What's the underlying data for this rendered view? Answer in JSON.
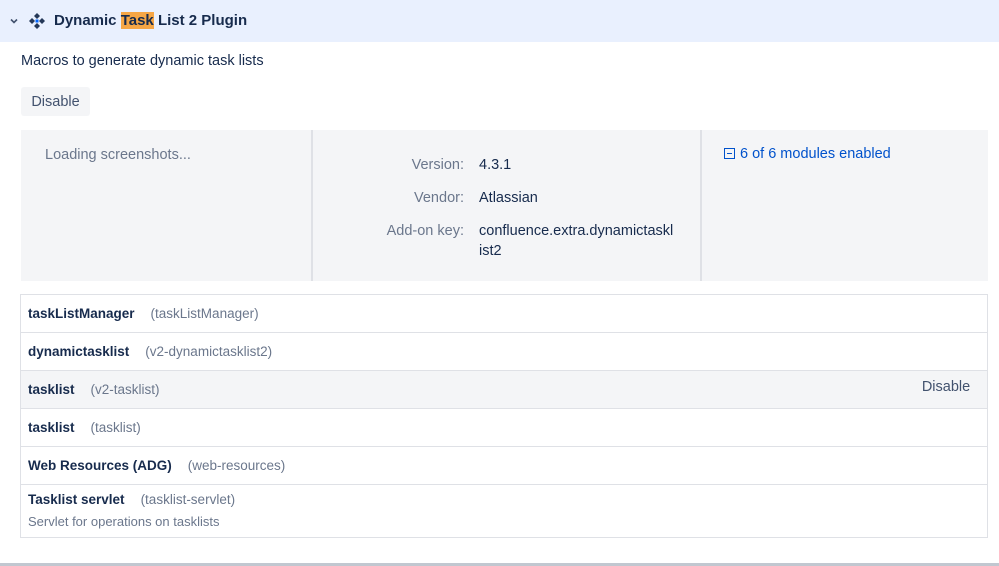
{
  "plugin": {
    "title_prefix": "Dynamic ",
    "title_highlight": "Task",
    "title_suffix": " List 2 Plugin",
    "description": "Macros to generate dynamic task lists",
    "disable_label": "Disable"
  },
  "info": {
    "loading": "Loading screenshots...",
    "version_label": "Version:",
    "version_value": "4.3.1",
    "vendor_label": "Vendor:",
    "vendor_value": "Atlassian",
    "key_label": "Add-on key:",
    "key_value_line1": "confluence.extra.dynamictaskl",
    "key_value_line2": "ist2",
    "modules_link": "6 of 6 modules enabled"
  },
  "modules": [
    {
      "name": "taskListManager",
      "key": "(taskListManager)"
    },
    {
      "name": "dynamictasklist",
      "key": "(v2-dynamictasklist2)"
    },
    {
      "name": "tasklist",
      "key": "(v2-tasklist)",
      "action": "Disable"
    },
    {
      "name": "tasklist",
      "key": "(tasklist)"
    },
    {
      "name": "Web Resources (ADG)",
      "key": "(web-resources)"
    },
    {
      "name": "Tasklist servlet",
      "key": "(tasklist-servlet)",
      "description": "Servlet for operations on tasklists"
    }
  ],
  "colors": {
    "header_bg": "#e9f0fe",
    "highlight": "#f6a645",
    "link": "#0052cc",
    "panel_bg": "#f4f5f7"
  }
}
